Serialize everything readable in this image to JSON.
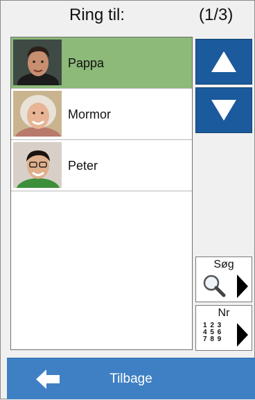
{
  "header": {
    "title": "Ring til:",
    "page_counter": "(1/3)"
  },
  "contacts": [
    {
      "name": "Pappa",
      "selected": true
    },
    {
      "name": "Mormor",
      "selected": false
    },
    {
      "name": "Peter",
      "selected": false
    }
  ],
  "nav": {
    "up_icon": "triangle-up-icon",
    "down_icon": "triangle-down-icon"
  },
  "side_buttons": {
    "search": {
      "label": "Søg",
      "icon": "magnifier-icon"
    },
    "number": {
      "label": "Nr",
      "icon": "keypad-digits-icon",
      "digits": [
        "1 2 3",
        "4 5 6",
        "7 8 9"
      ]
    }
  },
  "footer": {
    "back_label": "Tilbage",
    "icon": "arrow-left-icon"
  },
  "colors": {
    "accent": "#1b5a9c",
    "selected_row": "#8db979",
    "footer": "#3f80c4"
  }
}
